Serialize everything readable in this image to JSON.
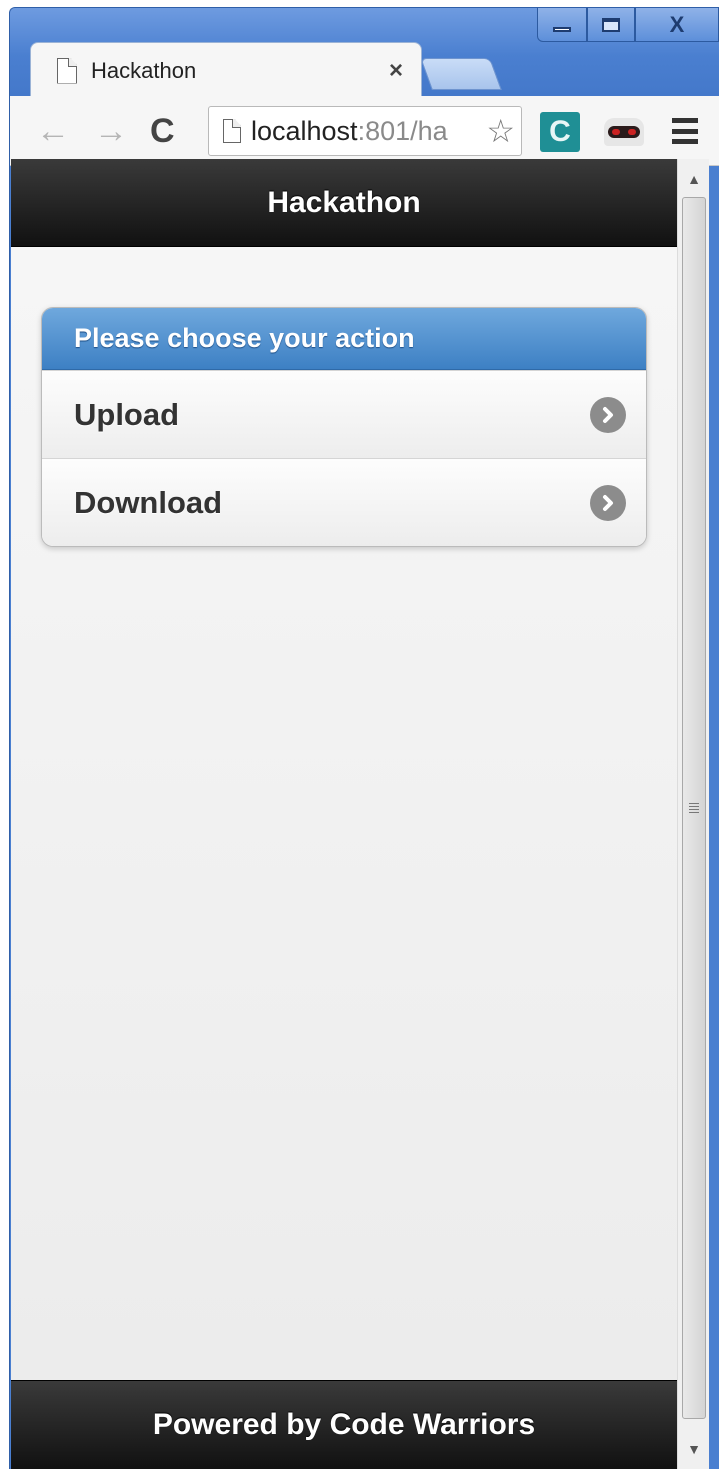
{
  "window": {
    "controls": {
      "minimize_label": "",
      "maximize_label": "",
      "close_label": "X"
    }
  },
  "tab": {
    "title": "Hackathon",
    "close_glyph": "×",
    "icon": "page-icon"
  },
  "toolbar": {
    "back_glyph": "←",
    "forward_glyph": "→",
    "reload_glyph": "C",
    "url_host": "localhost",
    "url_rest": ":801/ha",
    "star_glyph": "☆",
    "extension1_glyph": "C",
    "icons": [
      "back-arrow-icon",
      "forward-arrow-icon",
      "reload-icon",
      "page-icon",
      "star-icon",
      "extension-icon",
      "incognito-mask-icon",
      "menu-icon"
    ]
  },
  "page": {
    "header_title": "Hackathon",
    "list": {
      "divider": "Please choose your action",
      "items": [
        {
          "label": "Upload",
          "icon": "chevron-right-icon"
        },
        {
          "label": "Download",
          "icon": "chevron-right-icon"
        }
      ]
    },
    "footer_text": "Powered by Code Warriors"
  },
  "scrollbar": {
    "up_glyph": "▲",
    "down_glyph": "▼"
  },
  "colors": {
    "header_bg": "#111111",
    "divider_bg": "#3d80c4",
    "window_frame": "#4a7fd0",
    "arrow_icon": "#8c8c8c"
  }
}
